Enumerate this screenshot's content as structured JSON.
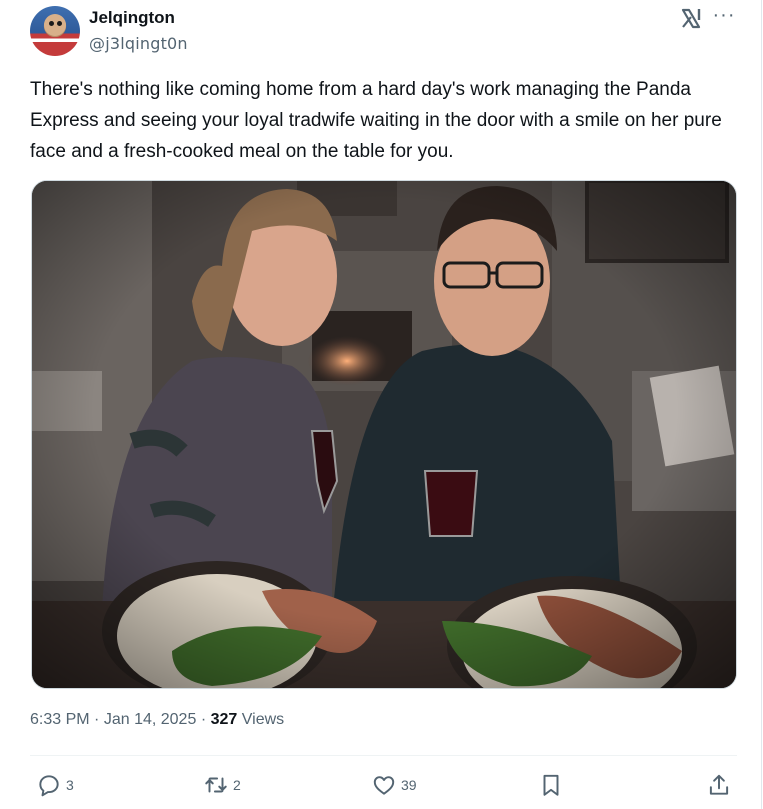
{
  "tweet": {
    "author": {
      "display_name": "Jelqington",
      "handle": "@j3lqingt0n",
      "avatar": "avatar-image"
    },
    "text": "There's nothing like coming home from a hard day's work managing the Panda Express and seeing your loyal tradwife waiting in the door with a smile on her pure face and a fresh-cooked meal on the table for you.",
    "media": {
      "type": "photo"
    },
    "time": "6:33 PM",
    "separator": "·",
    "date": "Jan 14, 2025",
    "views_count": "327",
    "views_label": "Views"
  },
  "actions": {
    "reply_count": "3",
    "repost_count": "2",
    "like_count": "39"
  },
  "icons": {
    "grok": "grok-icon",
    "more": "more-icon",
    "reply": "reply-icon",
    "repost": "repost-icon",
    "like": "heart-icon",
    "bookmark": "bookmark-icon",
    "share": "share-icon"
  },
  "colors": {
    "text_primary": "#0f1419",
    "text_secondary": "#536471",
    "border": "#cfd9de"
  }
}
